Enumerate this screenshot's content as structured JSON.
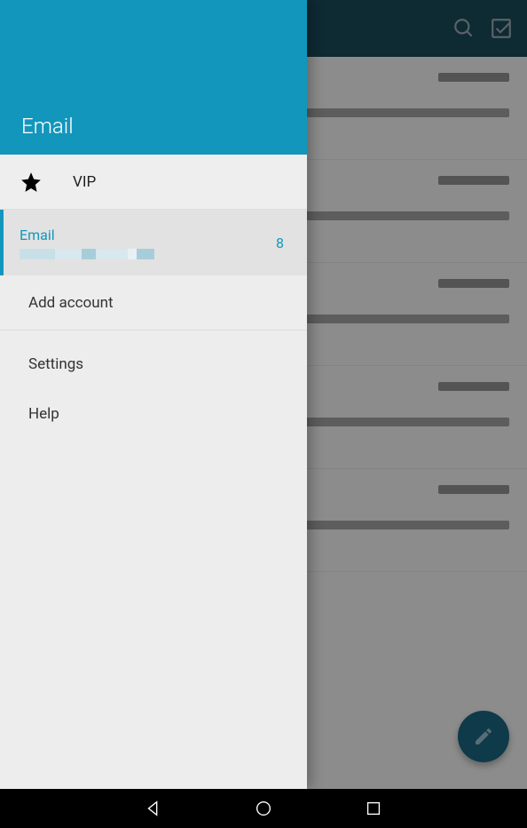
{
  "drawer": {
    "title": "Email",
    "vip_label": "VIP",
    "account": {
      "name": "Email",
      "count": "8"
    },
    "add_account": "Add account",
    "settings": "Settings",
    "help": "Help"
  }
}
